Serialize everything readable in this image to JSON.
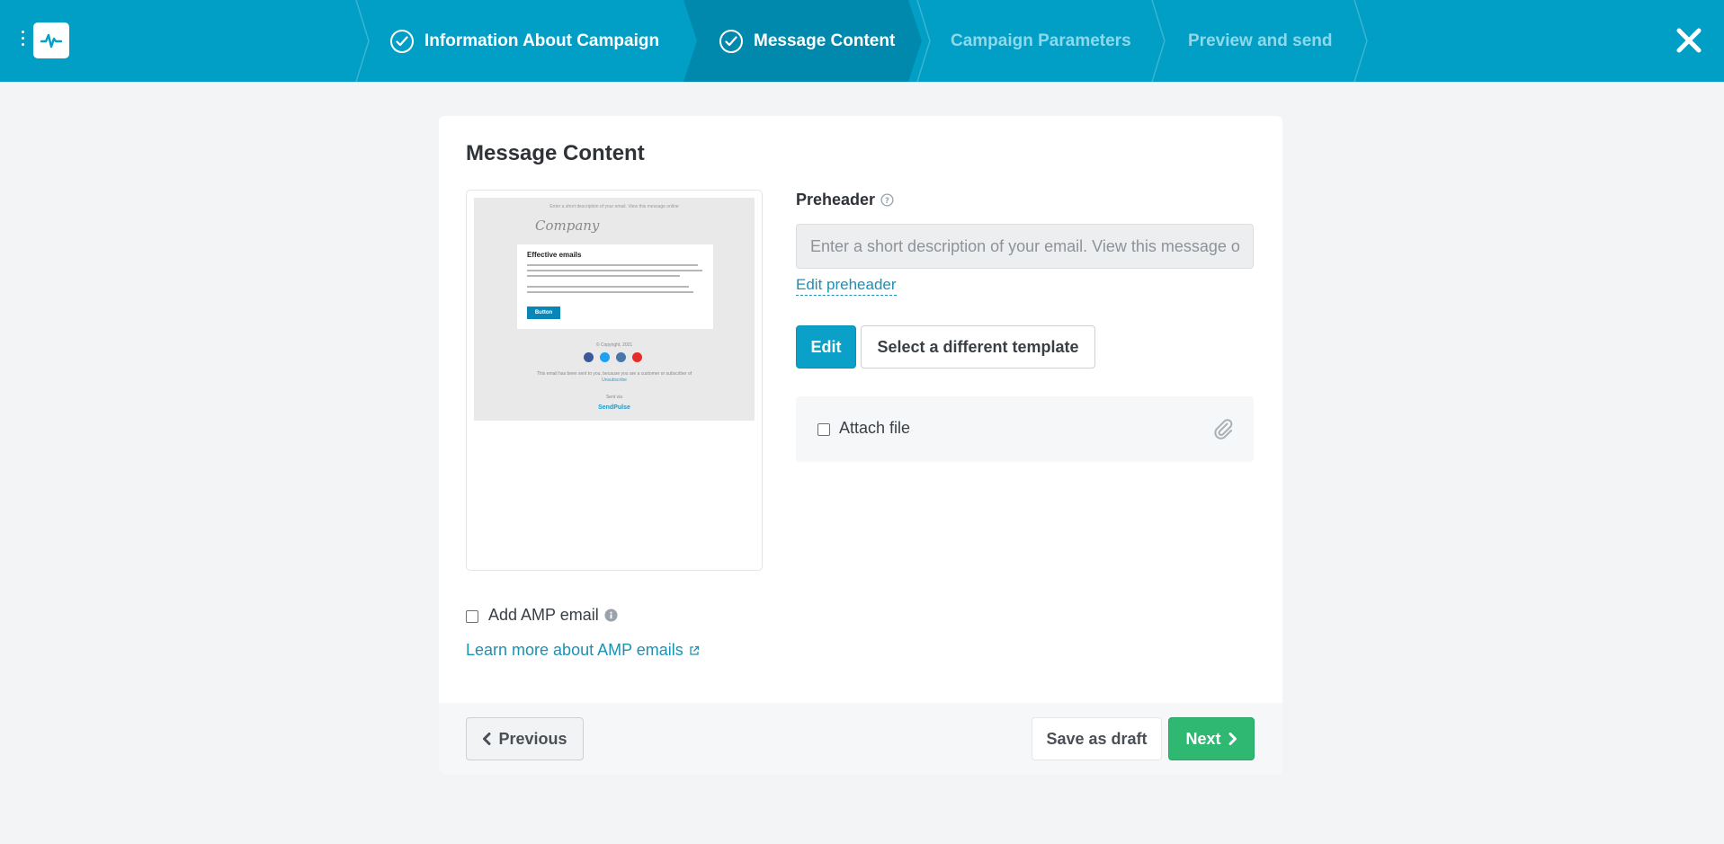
{
  "app": {
    "logo_icon": "pulse-icon",
    "menu_icon": "vertical-dots-icon",
    "close_icon": "close-icon",
    "accent_color": "#019fc6",
    "active_step_color": "#0189ad"
  },
  "steps": [
    {
      "label": "Information About Campaign",
      "status": "completed",
      "icon": "check-circle-icon"
    },
    {
      "label": "Message Content",
      "status": "active",
      "icon": "check-circle-icon"
    },
    {
      "label": "Campaign Parameters",
      "status": "upcoming"
    },
    {
      "label": "Preview and send",
      "status": "upcoming"
    }
  ],
  "content": {
    "title": "Message Content",
    "preview": {
      "top_text": "Enter a short description of your email. View this message online",
      "company": "Company",
      "heading": "Effective emails",
      "button": "Button",
      "copyright": "© Copyright, 2021",
      "footer_text": "This email has been sent to you, because you are a customer or subscriber of",
      "unsubscribe": "Unsubscribe",
      "sent_via": "Sent via",
      "brand": "SendPulse"
    },
    "preheader": {
      "label": "Preheader",
      "help_icon": "question-circle-icon",
      "placeholder": "Enter a short description of your email. View this message online",
      "value": "",
      "edit_link": "Edit preheader"
    },
    "edit_button": "Edit",
    "template_button": "Select a different template",
    "attach": {
      "label": "Attach file",
      "checked": false,
      "icon": "paperclip-icon"
    },
    "amp": {
      "label": "Add AMP email",
      "checked": false,
      "info_icon": "info-circle-icon",
      "learn_more": "Learn more about AMP emails",
      "external_icon": "external-link-icon"
    }
  },
  "footer": {
    "previous": "Previous",
    "save_draft": "Save as draft",
    "next": "Next",
    "next_color": "#2eb872"
  }
}
